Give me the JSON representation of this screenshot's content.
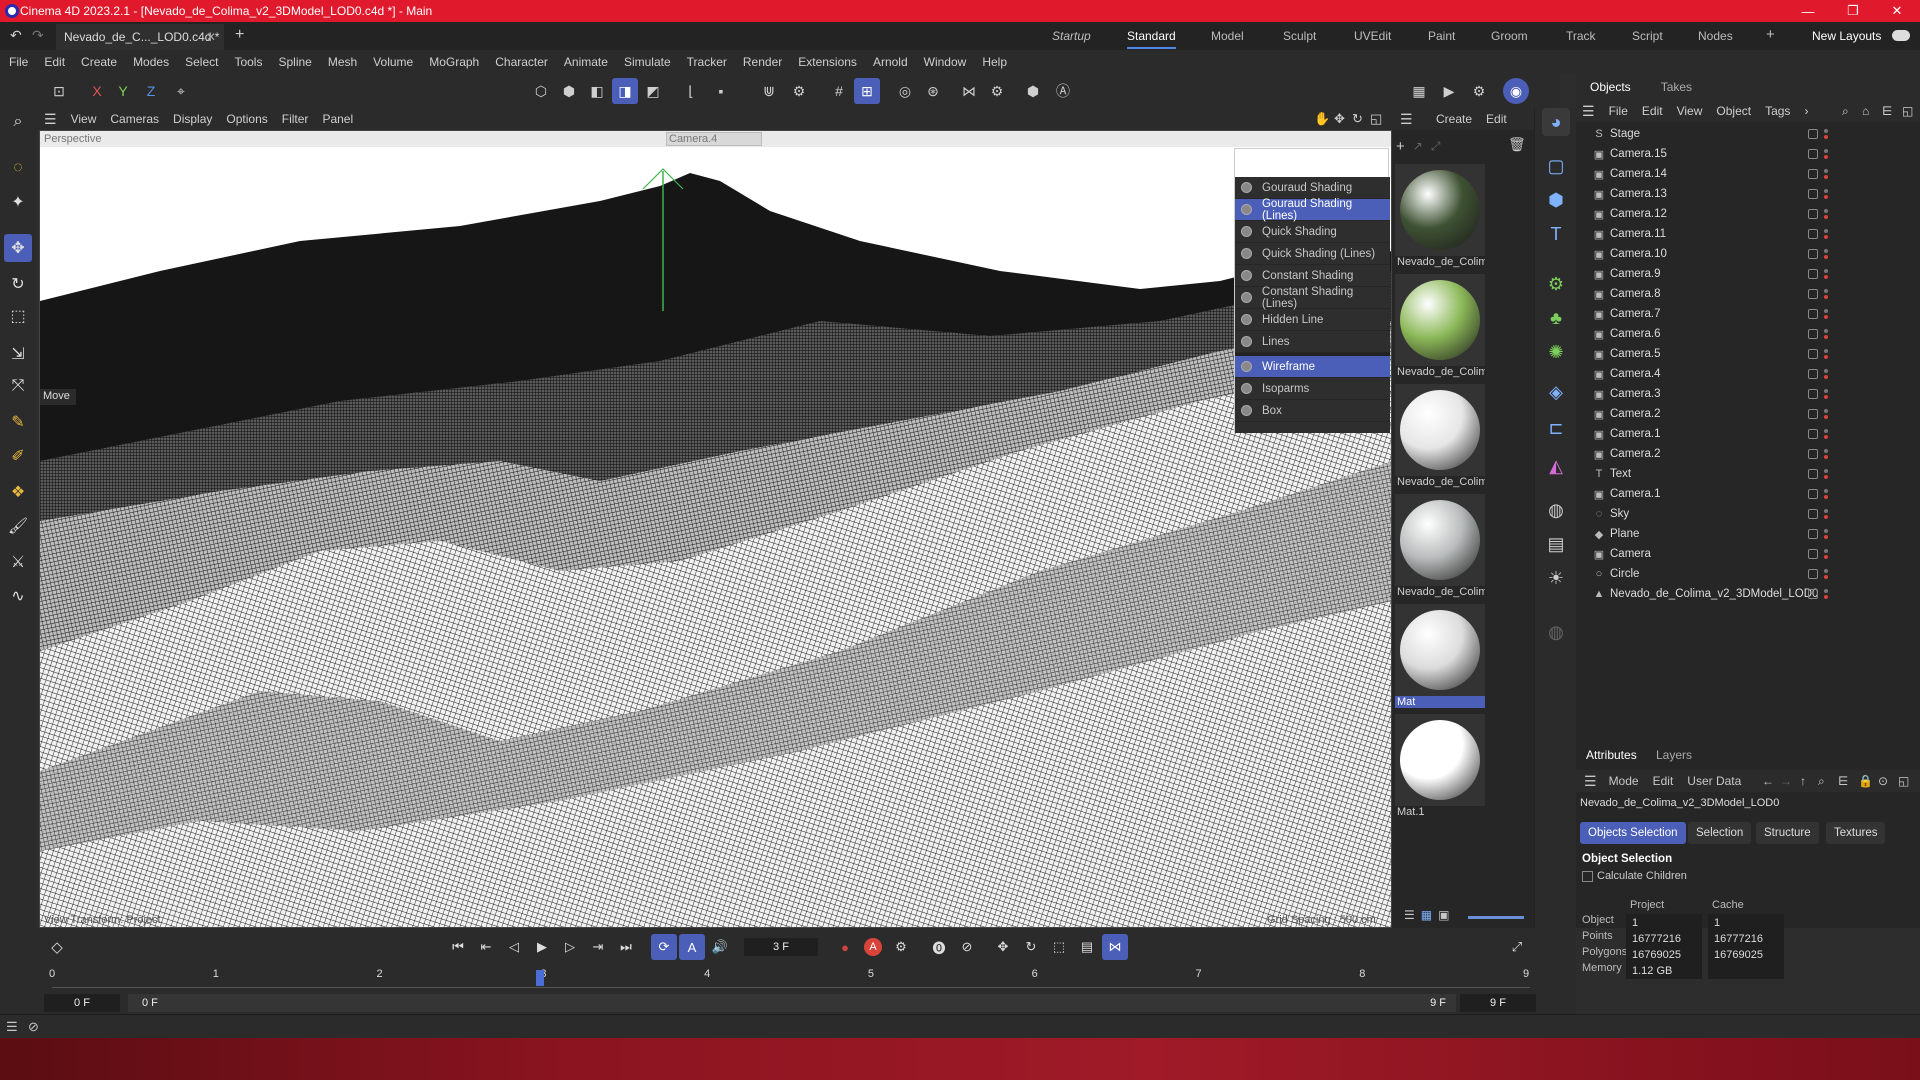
{
  "window": {
    "title": "Cinema 4D 2023.2.1 - [Nevado_de_Colima_v2_3DModel_LOD0.c4d *] - Main",
    "controls": [
      "—",
      "❐",
      "✕"
    ]
  },
  "tabbar": {
    "doc_tab": "Nevado_de_C..._LOD0.c4d *",
    "close": "✕",
    "add": "+",
    "layouts": [
      "Startup",
      "Standard",
      "Model",
      "Sculpt",
      "UVEdit",
      "Paint",
      "Groom",
      "Track",
      "Script",
      "Nodes"
    ],
    "active_layout": "Standard",
    "new_layouts": "New Layouts"
  },
  "menubar": [
    "File",
    "Edit",
    "Create",
    "Modes",
    "Select",
    "Tools",
    "Spline",
    "Mesh",
    "Volume",
    "MoGraph",
    "Character",
    "Animate",
    "Simulate",
    "Tracker",
    "Render",
    "Extensions",
    "Arnold",
    "Window",
    "Help"
  ],
  "toolbar": {
    "axis": [
      "X",
      "Y",
      "Z"
    ]
  },
  "viewport": {
    "menu": [
      "View",
      "Cameras",
      "Display",
      "Options",
      "Filter",
      "Panel"
    ],
    "label_perspective": "Perspective",
    "camera_name": "Camera.4",
    "move_label": "Move",
    "bottom_left": "View Transform: Project",
    "bottom_right": "Grid Spacing : 500 cm"
  },
  "shading_menu": {
    "items": [
      {
        "label": "Gouraud Shading",
        "highlight": false
      },
      {
        "label": "Gouraud Shading (Lines)",
        "highlight": true
      },
      {
        "label": "Quick Shading",
        "highlight": false
      },
      {
        "label": "Quick Shading (Lines)",
        "highlight": false
      },
      {
        "label": "Constant Shading",
        "highlight": false
      },
      {
        "label": "Constant Shading (Lines)",
        "highlight": false
      },
      {
        "label": "Hidden Line",
        "highlight": false
      },
      {
        "label": "Lines",
        "highlight": false
      },
      {
        "label": "Wireframe",
        "highlight": true
      },
      {
        "label": "Isoparms",
        "highlight": false
      },
      {
        "label": "Box",
        "highlight": false
      }
    ]
  },
  "materials": {
    "menu": [
      "Create",
      "Edit"
    ],
    "items": [
      {
        "name": "Nevado_de_Colim",
        "color": "#3f5233"
      },
      {
        "name": "Nevado_de_Colim",
        "color": "#8cb858"
      },
      {
        "name": "Nevado_de_Colim",
        "color": "#e6e6e6"
      },
      {
        "name": "Nevado_de_Colim",
        "color": "#b9bcbc"
      },
      {
        "name": "Mat",
        "color": "#dcdcdc"
      },
      {
        "name": "Mat.1",
        "color": "#ffffff"
      }
    ]
  },
  "objects": {
    "tabs": [
      "Objects",
      "Takes"
    ],
    "menu": [
      "File",
      "Edit",
      "View",
      "Object",
      "Tags"
    ],
    "rows": [
      {
        "name": "Stage",
        "icon": "S"
      },
      {
        "name": "Camera.15",
        "icon": "▣"
      },
      {
        "name": "Camera.14",
        "icon": "▣"
      },
      {
        "name": "Camera.13",
        "icon": "▣"
      },
      {
        "name": "Camera.12",
        "icon": "▣"
      },
      {
        "name": "Camera.11",
        "icon": "▣"
      },
      {
        "name": "Camera.10",
        "icon": "▣"
      },
      {
        "name": "Camera.9",
        "icon": "▣"
      },
      {
        "name": "Camera.8",
        "icon": "▣"
      },
      {
        "name": "Camera.7",
        "icon": "▣"
      },
      {
        "name": "Camera.6",
        "icon": "▣"
      },
      {
        "name": "Camera.5",
        "icon": "▣"
      },
      {
        "name": "Camera.4",
        "icon": "▣"
      },
      {
        "name": "Camera.3",
        "icon": "▣"
      },
      {
        "name": "Camera.2",
        "icon": "▣"
      },
      {
        "name": "Camera.1",
        "icon": "▣"
      },
      {
        "name": "Camera.2",
        "icon": "▣"
      },
      {
        "name": "Text",
        "icon": "T"
      },
      {
        "name": "Camera.1",
        "icon": "▣"
      },
      {
        "name": "Sky",
        "icon": "◌"
      },
      {
        "name": "Plane",
        "icon": "◆"
      },
      {
        "name": "Camera",
        "icon": "▣"
      },
      {
        "name": "Circle",
        "icon": "○"
      },
      {
        "name": "Nevado_de_Colima_v2_3DModel_LOD0",
        "icon": "▲"
      }
    ]
  },
  "attributes": {
    "tabs": [
      "Attributes",
      "Layers"
    ],
    "menu": [
      "Mode",
      "Edit",
      "User Data"
    ],
    "object_name": "Nevado_de_Colima_v2_3DModel_LOD0",
    "subtabs": [
      "Objects Selection",
      "Selection",
      "Structure",
      "Textures"
    ],
    "section": "Object Selection",
    "calc_children": "Calculate Children",
    "col_project": "Project",
    "col_cache": "Cache",
    "stats": [
      {
        "label": "Object",
        "project": "1",
        "cache": "1"
      },
      {
        "label": "Points",
        "project": "16777216",
        "cache": "16777216"
      },
      {
        "label": "Polygons",
        "project": "16769025",
        "cache": "16769025"
      },
      {
        "label": "Memory",
        "project": "1.12 GB",
        "cache": ""
      }
    ]
  },
  "timeline": {
    "current_frame": "3 F",
    "start": "0 F",
    "start2": "0 F",
    "end": "9 F",
    "end2": "9 F",
    "ticks": [
      "0",
      "1",
      "2",
      "3",
      "4",
      "5",
      "6",
      "7",
      "8",
      "9"
    ],
    "playhead_frame": 3
  }
}
